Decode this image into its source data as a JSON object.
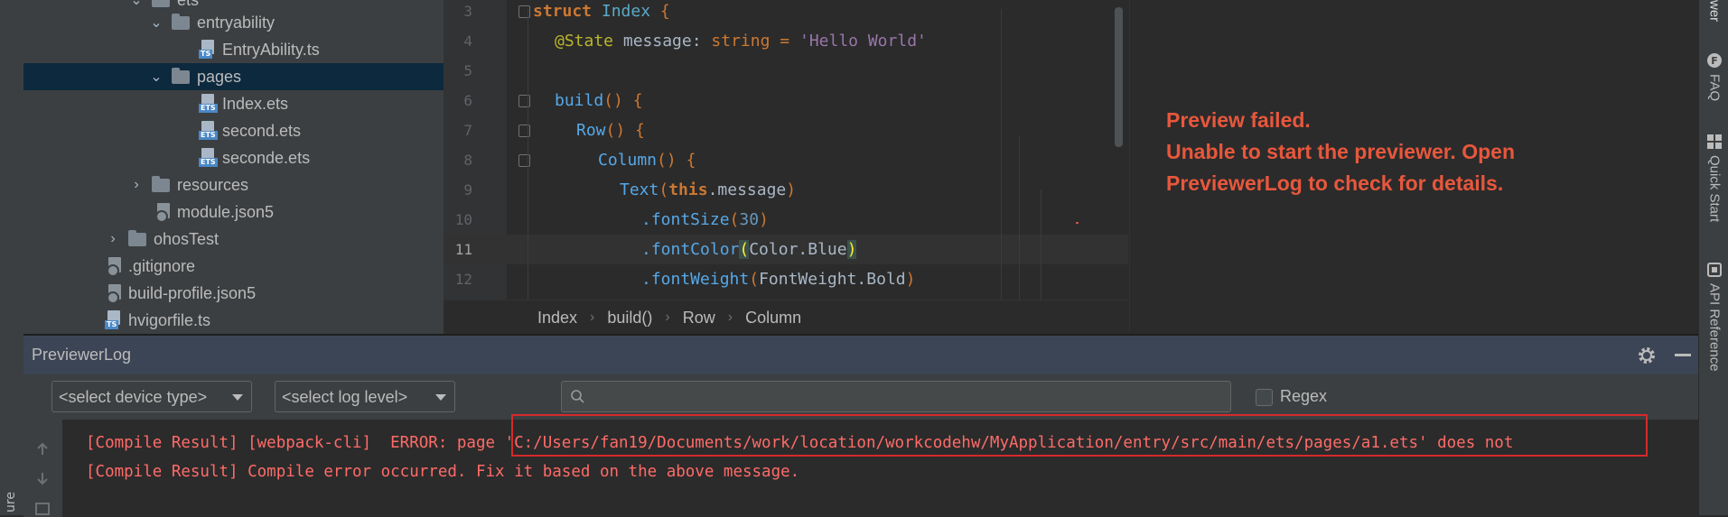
{
  "left_strip": {
    "bottom_label": "ure"
  },
  "tree": {
    "items": [
      {
        "label": "ets",
        "type": "folder",
        "expanded": true
      },
      {
        "label": "entryability",
        "type": "folder",
        "expanded": true
      },
      {
        "label": "EntryAbility.ts",
        "type": "file",
        "badge": "TS"
      },
      {
        "label": "pages",
        "type": "folder",
        "expanded": true,
        "selected": true
      },
      {
        "label": "Index.ets",
        "type": "file",
        "badge": "ETS"
      },
      {
        "label": "second.ets",
        "type": "file",
        "badge": "ETS"
      },
      {
        "label": "seconde.ets",
        "type": "file",
        "badge": "ETS"
      },
      {
        "label": "resources",
        "type": "folder",
        "expanded": false
      },
      {
        "label": "module.json5",
        "type": "config"
      },
      {
        "label": "ohosTest",
        "type": "folder",
        "expanded": false
      },
      {
        "label": ".gitignore",
        "type": "config"
      },
      {
        "label": "build-profile.json5",
        "type": "config"
      },
      {
        "label": "hvigorfile.ts",
        "type": "file",
        "badge": "TS"
      }
    ]
  },
  "editor": {
    "line_numbers": [
      "3",
      "4",
      "5",
      "6",
      "7",
      "8",
      "9",
      "10",
      "11",
      "12"
    ],
    "current_line": "11",
    "code": {
      "l3": {
        "struct": "struct",
        "name": "Index",
        "brace": "{"
      },
      "l4": {
        "decorator": "@State",
        "var": "message",
        "colon": ":",
        "type": "string",
        "eq": "=",
        "value": "'Hello World'"
      },
      "l6": {
        "name": "build",
        "parens": "()",
        "brace": "{"
      },
      "l7": {
        "name": "Row",
        "parens": "()",
        "brace": "{"
      },
      "l8": {
        "name": "Column",
        "parens": "()",
        "brace": "{"
      },
      "l9": {
        "name": "Text",
        "open": "(",
        "this": "this",
        "rest": ".message",
        "close": ")"
      },
      "l10": {
        "method": ".fontSize",
        "open": "(",
        "arg": "30",
        "close": ")"
      },
      "l11": {
        "method": ".fontColor",
        "open": "(",
        "arg": "Color.Blue",
        "close": ")"
      },
      "l12": {
        "method": ".fontWeight",
        "open": "(",
        "arg": "FontWeight.Bold",
        "close": ")"
      }
    },
    "breadcrumb": [
      "Index",
      "build()",
      "Row",
      "Column"
    ]
  },
  "preview": {
    "lines": [
      "Preview failed.",
      "Unable to start the previewer. Open",
      "PreviewerLog to check for details."
    ]
  },
  "right_strip": {
    "top_label": "wer",
    "items": [
      {
        "label": "FAQ",
        "icon": "faq-icon"
      },
      {
        "label": "Quick Start",
        "icon": "quick-start-icon"
      },
      {
        "label": "API Reference",
        "icon": "api-reference-icon"
      }
    ]
  },
  "log": {
    "title": "PreviewerLog",
    "device_select": "<select device type>",
    "level_select": "<select log level>",
    "search_placeholder": "",
    "regex_label": "Regex",
    "lines": [
      "[Compile Result] [webpack-cli]  ERROR: page 'C:/Users/fan19/Documents/work/location/workcodehw/MyApplication/entry/src/main/ets/pages/a1.ets' does not",
      "[Compile Result] Compile error occurred. Fix it based on the above message."
    ]
  },
  "colors": {
    "error_text": "#ff6b68",
    "preview_error": "#e8573c",
    "highlight_box": "#d62a2a",
    "selection": "#0d293e"
  }
}
